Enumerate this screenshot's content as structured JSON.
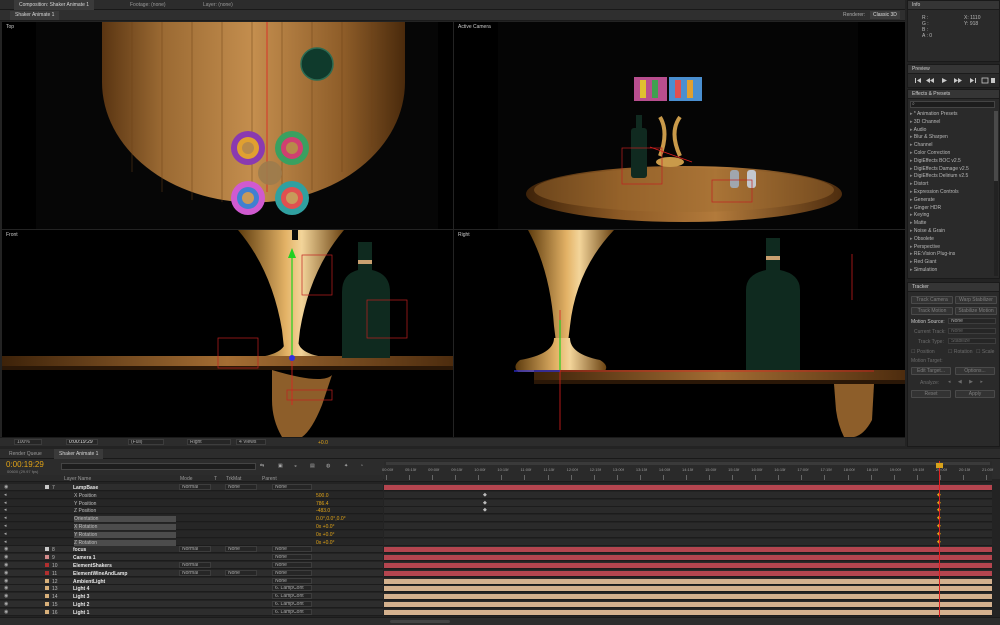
{
  "top_tabs": {
    "composition": "Composition: Shaker Animate 1",
    "footage": "Footage: (none)",
    "layer": "Layer: (none)"
  },
  "comp_subtab": "Shaker Animate 1",
  "renderer": {
    "label": "Renderer:",
    "value": "Classic 3D"
  },
  "views": {
    "top": "Top",
    "active": "Active Camera",
    "front": "Front",
    "right": "Right"
  },
  "viewer_toolbar": {
    "zoom": "100%",
    "timecode": "0:00:19:29",
    "resolution": "(Full)",
    "view": "Right",
    "layout": "4 Views",
    "exposure": "+0.0"
  },
  "info": {
    "title": "Info",
    "r": "R :",
    "g": "G :",
    "b": "B :",
    "a": "A : 0",
    "x": "X: 1110",
    "y": "Y: 918"
  },
  "preview": {
    "title": "Preview"
  },
  "effects": {
    "title": "Effects & Presets",
    "search": "",
    "items": [
      "* Animation Presets",
      "3D Channel",
      "Audio",
      "Blur & Sharpen",
      "Channel",
      "Color Correction",
      "DigiEffects BOC v2.5",
      "DigiEffects Damage v2.5",
      "DigiEffects Delirium v2.5",
      "Distort",
      "Expression Controls",
      "Generate",
      "Ginger HDR",
      "Keying",
      "Matte",
      "Noise & Grain",
      "Obsolete",
      "Perspective",
      "RE:Vision Plug-ins",
      "Red Giant",
      "Simulation"
    ]
  },
  "tracker": {
    "title": "Tracker",
    "track_camera": "Track Camera",
    "warp_stabilizer": "Warp Stabilizer",
    "track_motion": "Track Motion",
    "stabilize_motion": "Stabilize Motion",
    "motion_source_label": "Motion Source:",
    "motion_source_value": "None",
    "current_track_label": "Current Track:",
    "current_track_value": "None",
    "track_type_label": "Track Type:",
    "track_type_value": "Stabilize",
    "position": "Position",
    "rotation": "Rotation",
    "scale": "Scale",
    "motion_target": "Motion Target:",
    "edit_target": "Edit Target...",
    "options": "Options...",
    "analyze": "Analyze:",
    "reset": "Reset",
    "apply": "Apply"
  },
  "bottom_tabs": {
    "render_queue": "Render Queue",
    "timeline": "Shaker Animate 1"
  },
  "timeline": {
    "timecode": "0:00:19:29",
    "frame_info": "00600 (29.97 fps)",
    "search": "",
    "headers": {
      "layer_name": "Layer Name",
      "mode": "Mode",
      "t": "T",
      "trkmat": "TrkMat",
      "parent": "Parent"
    },
    "ruler": [
      "00:00f",
      "05:15f",
      "09:00f",
      "09:15f",
      "10:00f",
      "10:15f",
      "11:00f",
      "11:15f",
      "12:00f",
      "12:15f",
      "13:00f",
      "13:15f",
      "14:00f",
      "14:15f",
      "15:00f",
      "15:15f",
      "16:00f",
      "16:15f",
      "17:00f",
      "17:15f",
      "18:00f",
      "18:15f",
      "19:00f",
      "19:15f",
      "20:00f",
      "20:15f",
      "21:00f"
    ],
    "layers": [
      {
        "num": "7",
        "name": "LampBase",
        "mode": "Normal",
        "trkmat": "None",
        "parent": "None",
        "color": "#c9c9c9",
        "kind": "layer",
        "bar": "#b4454f"
      },
      {
        "num": "",
        "name": "X Position",
        "value": "500.0",
        "kind": "prop"
      },
      {
        "num": "",
        "name": "Y Position",
        "value": "786.4",
        "kind": "prop"
      },
      {
        "num": "",
        "name": "Z Position",
        "value": "-483.0",
        "kind": "prop"
      },
      {
        "num": "",
        "name": "Orientation",
        "value": "0.0°,0.0°,0.0°",
        "kind": "prop",
        "hl": true
      },
      {
        "num": "",
        "name": "X Rotation",
        "value": "0x +0.0°",
        "kind": "prop",
        "hl": true
      },
      {
        "num": "",
        "name": "Y Rotation",
        "value": "0x +0.0°",
        "kind": "prop",
        "hl": true
      },
      {
        "num": "",
        "name": "Z Rotation",
        "value": "0x +0.0°",
        "kind": "prop",
        "hl": true
      },
      {
        "num": "8",
        "name": "focus",
        "mode": "Normal",
        "trkmat": "None",
        "parent": "None",
        "color": "#c9c9c9",
        "kind": "layer",
        "bar": "#b4454f"
      },
      {
        "num": "9",
        "name": "Camera 1",
        "mode": "",
        "trkmat": "",
        "parent": "None",
        "color": "#d48b8b",
        "kind": "layer",
        "bar": "#b4454f"
      },
      {
        "num": "10",
        "name": "ElementShakers",
        "mode": "Normal",
        "trkmat": "",
        "parent": "None",
        "color": "#b12f2f",
        "kind": "layer",
        "bar": "#b4454f"
      },
      {
        "num": "11",
        "name": "ElementWineAndLamp",
        "mode": "Normal",
        "trkmat": "None",
        "parent": "None",
        "color": "#b12f2f",
        "kind": "layer",
        "bar": "#b4454f"
      },
      {
        "num": "12",
        "name": "AmbientLight",
        "mode": "",
        "trkmat": "",
        "parent": "None",
        "color": "#d8b07a",
        "kind": "layer",
        "bar": "#d4b18e"
      },
      {
        "num": "13",
        "name": "Light 4",
        "mode": "",
        "trkmat": "",
        "parent": "6. LampCont",
        "color": "#d8b07a",
        "kind": "layer",
        "bar": "#d4b18e"
      },
      {
        "num": "14",
        "name": "Light 3",
        "mode": "",
        "trkmat": "",
        "parent": "6. LampCont",
        "color": "#d8b07a",
        "kind": "layer",
        "bar": "#d4b18e"
      },
      {
        "num": "15",
        "name": "Light 2",
        "mode": "",
        "trkmat": "",
        "parent": "6. LampCont",
        "color": "#d8b07a",
        "kind": "layer",
        "bar": "#d4b18e"
      },
      {
        "num": "16",
        "name": "Light 1",
        "mode": "",
        "trkmat": "",
        "parent": "6. LampCont",
        "color": "#d8b07a",
        "kind": "layer",
        "bar": "#d4b18e"
      }
    ]
  }
}
